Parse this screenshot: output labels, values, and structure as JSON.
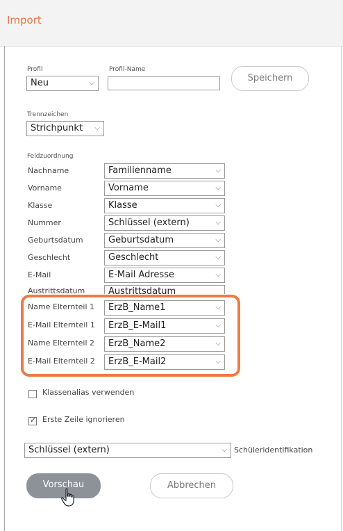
{
  "dialog": {
    "title": "Import"
  },
  "profile": {
    "profil_label": "Profil",
    "profil_value": "Neu",
    "profil_name_label": "Profil-Name",
    "profil_name_value": "",
    "save_label": "Speichern"
  },
  "separator": {
    "label": "Trennzeichen",
    "value": "Strichpunkt"
  },
  "mapping": {
    "label": "Feldzuordnung",
    "rows": [
      {
        "label": "Nachname",
        "value": "Familienname"
      },
      {
        "label": "Vorname",
        "value": "Vorname"
      },
      {
        "label": "Klasse",
        "value": "Klasse"
      },
      {
        "label": "Nummer",
        "value": "Schlüssel (extern)"
      },
      {
        "label": "Geburtsdatum",
        "value": "Geburtsdatum"
      },
      {
        "label": "Geschlecht",
        "value": "Geschlecht"
      },
      {
        "label": "E-Mail",
        "value": "E-Mail Adresse"
      },
      {
        "label": "Austrittsdatum",
        "value": "Austrittsdatum"
      },
      {
        "label": "Name Elternteil 1",
        "value": "ErzB_Name1"
      },
      {
        "label": "E-Mail Elternteil 1",
        "value": "ErzB_E-Mail1"
      },
      {
        "label": "Name Elternteil 2",
        "value": "ErzB_Name2"
      },
      {
        "label": "E-Mail Elternteil 2",
        "value": "ErzB_E-Mail2"
      }
    ]
  },
  "options": {
    "class_alias": {
      "label": "Klassenalias verwenden",
      "checked": false
    },
    "ignore_first_row": {
      "label": "Erste Zeile ignorieren",
      "checked": true
    }
  },
  "identification": {
    "value": "Schlüssel (extern)",
    "label": "Schüleridentifikation"
  },
  "actions": {
    "preview": "Vorschau",
    "cancel": "Abbrechen"
  },
  "icons": {
    "dropdown": "chevron-down-icon",
    "checkmark": "check-icon",
    "cursor": "hand-cursor-icon"
  },
  "colors": {
    "title": "#e8734a",
    "highlight": "#f07a45",
    "primary_button": "#8c9298"
  }
}
